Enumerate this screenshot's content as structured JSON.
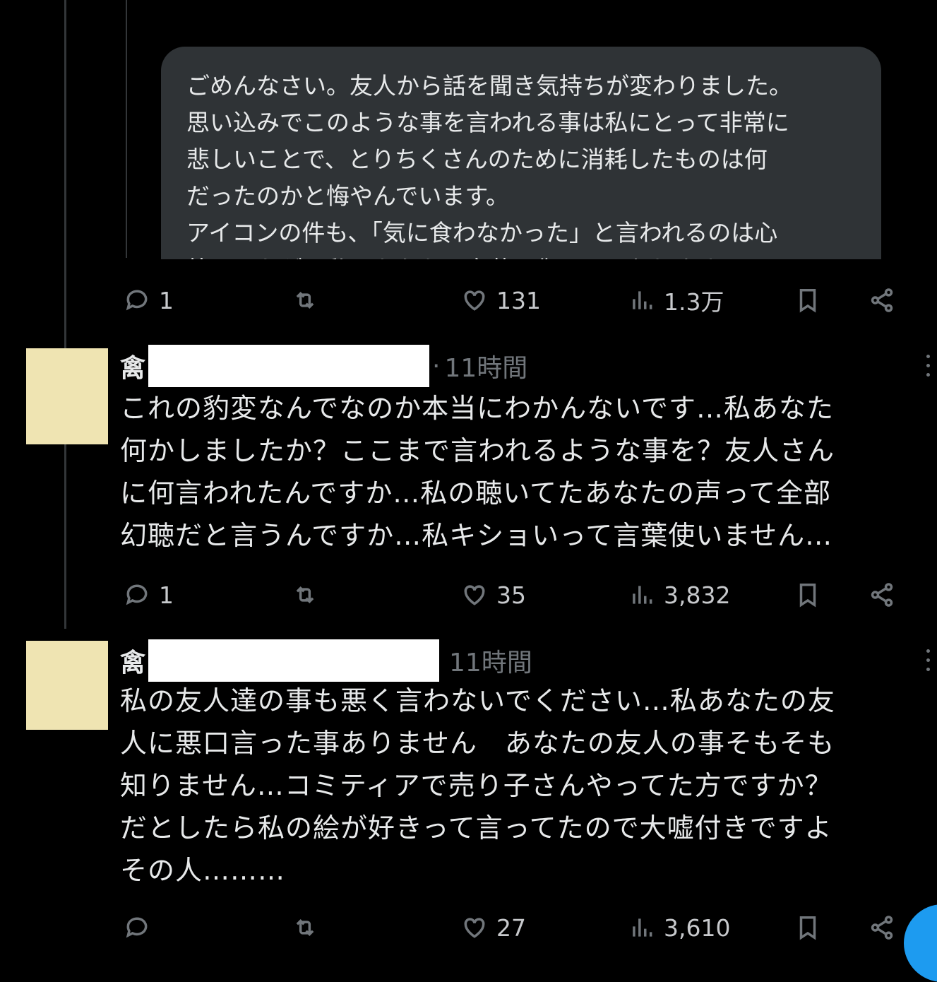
{
  "quoted_tweet": {
    "text": "ごめんなさい。友人から話を聞き気持ちが変わりました。\n思い込みでこのような事を言われる事は私にとって非常に\n悲しいことで、とりちくさんのために消耗したものは何\nだったのかと悔やんでいます。\nアイコンの件も、「気に食わなかった」と言われるのは心\n外でしたが、私はあなたの言葉に傷ついております"
  },
  "tweet1_actions": {
    "replies": "1",
    "likes": "131",
    "views": "1.3万"
  },
  "reply1": {
    "name_initial": "禽",
    "time_sep": "·",
    "time": "11時間",
    "text": "これの豹変なんでなのか本当にわかんないです…私あなた\n何かしましたか？ここまで言われるような事を？友人さん\nに何言われたんですか…私の聴いてたあなたの声って全部\n幻聴だと言うんですか…私キショいって言葉使いません…",
    "replies": "1",
    "likes": "35",
    "views": "3,832"
  },
  "reply2": {
    "name_initial": "禽",
    "time": "11時間",
    "text": "私の友人達の事も悪く言わないでください…私あなたの友\n人に悪口言った事ありません　あなたの友人の事そもそも\n知りません…コミティアで売り子さんやってた方ですか？\nだとしたら私の絵が好きって言ってたので大嘘付きですよ\nその人………",
    "replies": "",
    "likes": "27",
    "views": "3,610"
  },
  "colors": {
    "background": "#000000",
    "text": "#e7e9ea",
    "muted": "#71767b",
    "card": "#2f3336",
    "avatar": "#efe4b2",
    "accent": "#1d9bf0"
  }
}
